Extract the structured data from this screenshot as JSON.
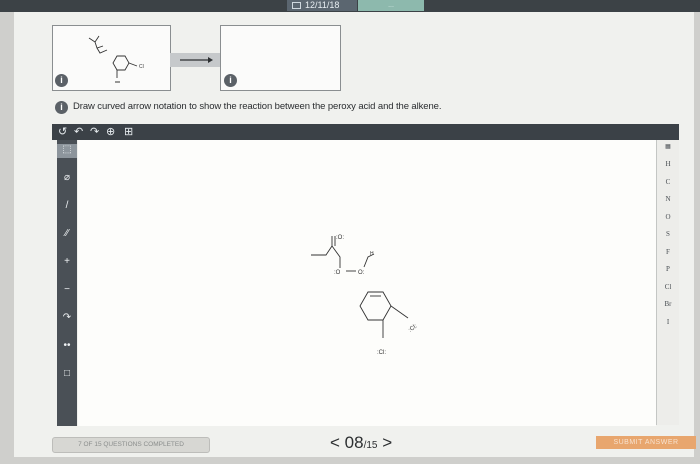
{
  "topbar": {
    "date": "12/11/18",
    "tab_label": "..."
  },
  "reaction": {
    "arrow_icon": "right-arrow-icon",
    "badge_label": "i"
  },
  "question": {
    "text": "Draw curved arrow notation to show the reaction between the peroxy acid and the alkene."
  },
  "toolbar": {
    "undo_icon": "↺",
    "redo_left_icon": "↶",
    "redo_right_icon": "↷",
    "zoom_icon": "⊕",
    "template_icon": "⊞"
  },
  "left_tools": [
    {
      "name": "select-tool",
      "glyph": "⬚",
      "selected": true
    },
    {
      "name": "eraser-tool",
      "glyph": "⌀",
      "selected": false
    },
    {
      "name": "bond-tool",
      "glyph": "/",
      "selected": false
    },
    {
      "name": "chain-tool",
      "glyph": "∕∕",
      "selected": false
    },
    {
      "name": "charge-plus-tool",
      "glyph": "+",
      "selected": false
    },
    {
      "name": "charge-minus-tool",
      "glyph": "−",
      "selected": false
    },
    {
      "name": "curved-arrow-tool",
      "glyph": "↷",
      "selected": false
    },
    {
      "name": "lone-pair-tool",
      "glyph": "••",
      "selected": false
    },
    {
      "name": "ring-tool",
      "glyph": "□",
      "selected": false
    }
  ],
  "elements": [
    "H",
    "C",
    "N",
    "O",
    "S",
    "F",
    "P",
    "Cl",
    "Br",
    "I"
  ],
  "molecule": {
    "labels": {
      "o_top": ":O:",
      "o_left": ":O",
      "o_right": "O:",
      "h": "H",
      "cl_top": ":Cl:",
      "cl_bottom": ":Cl:"
    }
  },
  "footer": {
    "progress_text": "7 OF 15 QUESTIONS COMPLETED",
    "pager_prev": "<",
    "pager_current": "08",
    "pager_total": "/15",
    "pager_next": ">",
    "submit": "SUBMIT ANSWER"
  }
}
